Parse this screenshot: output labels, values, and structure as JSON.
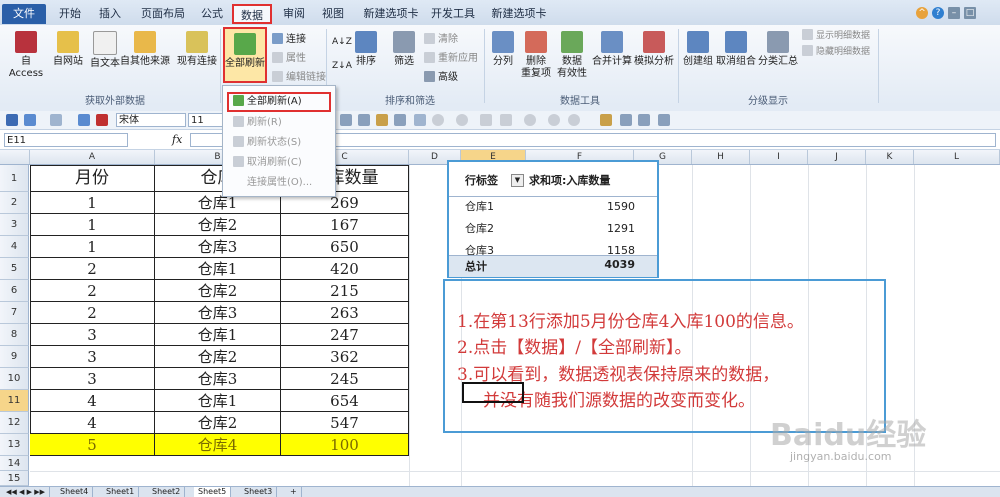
{
  "tabs": [
    "文件",
    "开始",
    "插入",
    "页面布局",
    "公式",
    "数据",
    "审阅",
    "视图",
    "新建选项卡",
    "开发工具",
    "新建选项卡"
  ],
  "ribbon": {
    "get_external": {
      "buttons": [
        "自 Access",
        "自网站",
        "自文本",
        "自其他来源",
        "现有连接"
      ],
      "label": "获取外部数据"
    },
    "connections": {
      "refresh_all": "全部刷新",
      "connect": "连接",
      "properties": "属性",
      "edit_links": "编辑链接"
    },
    "sort_filter": {
      "sort": "排序",
      "filter": "筛选",
      "clear": "清除",
      "reapply": "重新应用",
      "advanced": "高级",
      "label": "排序和筛选"
    },
    "data_tools": {
      "split": "分列",
      "remove_dup_line1": "删除",
      "remove_dup_line2": "重复项",
      "validation_line1": "数据",
      "validation_line2": "有效性",
      "consolidate": "合并计算",
      "whatif": "模拟分析",
      "label": "数据工具"
    },
    "outline": {
      "group": "创建组",
      "ungroup": "取消组合",
      "subtotal": "分类汇总",
      "show_detail": "显示明细数据",
      "hide_detail": "隐藏明细数据",
      "label": "分级显示"
    }
  },
  "menu": [
    "全部刷新(A)",
    "刷新(R)",
    "刷新状态(S)",
    "取消刷新(C)",
    "连接属性(O)..."
  ],
  "toolbar": {
    "font": "宋体",
    "size": "11"
  },
  "formula": {
    "namebox": "E11",
    "fx": "fx"
  },
  "columns": [
    "A",
    "B",
    "C",
    "D",
    "E",
    "F",
    "G",
    "H",
    "I",
    "J",
    "K",
    "L"
  ],
  "rows": [
    "1",
    "2",
    "3",
    "4",
    "5",
    "6",
    "7",
    "8",
    "9",
    "10",
    "11",
    "12",
    "13",
    "14",
    "15"
  ],
  "table": {
    "header": [
      "月份",
      "仓库",
      "入库数量"
    ],
    "rows": [
      [
        "1",
        "仓库1",
        "269"
      ],
      [
        "1",
        "仓库2",
        "167"
      ],
      [
        "1",
        "仓库3",
        "650"
      ],
      [
        "2",
        "仓库1",
        "420"
      ],
      [
        "2",
        "仓库2",
        "215"
      ],
      [
        "2",
        "仓库3",
        "263"
      ],
      [
        "3",
        "仓库1",
        "247"
      ],
      [
        "3",
        "仓库2",
        "362"
      ],
      [
        "3",
        "仓库3",
        "245"
      ],
      [
        "4",
        "仓库1",
        "654"
      ],
      [
        "4",
        "仓库2",
        "547"
      ],
      [
        "5",
        "仓库4",
        "100"
      ]
    ]
  },
  "pivot": {
    "header_left": "行标签",
    "header_right": "求和项:入库数量",
    "rows": [
      [
        "仓库1",
        "1590"
      ],
      [
        "仓库2",
        "1291"
      ],
      [
        "仓库3",
        "1158"
      ]
    ],
    "total_label": "总计",
    "total_value": "4039"
  },
  "note": [
    "1.在第13行添加5月份仓库4入库100的信息。",
    "2.点击【数据】/【全部刷新】。",
    "3.可以看到，数据透视表保持原来的数据，",
    "并没有随我们源数据的改变而变化。"
  ],
  "watermark": {
    "line1": "Baidu经验",
    "line2": "jingyan.baidu.com"
  },
  "sheets": [
    "Sheet4",
    "Sheet1",
    "Sheet2",
    "Sheet5",
    "Sheet3"
  ],
  "colors": {
    "highlight_row": "#ffff00",
    "accent_red": "#e03030",
    "pivot_border": "#4b9bd5",
    "note_text": "#d23a3a"
  }
}
